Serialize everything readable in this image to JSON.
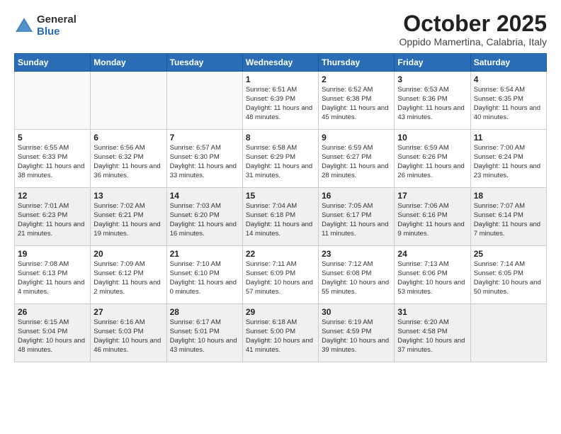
{
  "logo": {
    "general": "General",
    "blue": "Blue"
  },
  "title": "October 2025",
  "subtitle": "Oppido Mamertina, Calabria, Italy",
  "days_header": [
    "Sunday",
    "Monday",
    "Tuesday",
    "Wednesday",
    "Thursday",
    "Friday",
    "Saturday"
  ],
  "weeks": [
    [
      {
        "day": "",
        "info": "",
        "empty": true
      },
      {
        "day": "",
        "info": "",
        "empty": true
      },
      {
        "day": "",
        "info": "",
        "empty": true
      },
      {
        "day": "1",
        "info": "Sunrise: 6:51 AM\nSunset: 6:39 PM\nDaylight: 11 hours\nand 48 minutes."
      },
      {
        "day": "2",
        "info": "Sunrise: 6:52 AM\nSunset: 6:38 PM\nDaylight: 11 hours\nand 45 minutes."
      },
      {
        "day": "3",
        "info": "Sunrise: 6:53 AM\nSunset: 6:36 PM\nDaylight: 11 hours\nand 43 minutes."
      },
      {
        "day": "4",
        "info": "Sunrise: 6:54 AM\nSunset: 6:35 PM\nDaylight: 11 hours\nand 40 minutes."
      }
    ],
    [
      {
        "day": "5",
        "info": "Sunrise: 6:55 AM\nSunset: 6:33 PM\nDaylight: 11 hours\nand 38 minutes."
      },
      {
        "day": "6",
        "info": "Sunrise: 6:56 AM\nSunset: 6:32 PM\nDaylight: 11 hours\nand 36 minutes."
      },
      {
        "day": "7",
        "info": "Sunrise: 6:57 AM\nSunset: 6:30 PM\nDaylight: 11 hours\nand 33 minutes."
      },
      {
        "day": "8",
        "info": "Sunrise: 6:58 AM\nSunset: 6:29 PM\nDaylight: 11 hours\nand 31 minutes."
      },
      {
        "day": "9",
        "info": "Sunrise: 6:59 AM\nSunset: 6:27 PM\nDaylight: 11 hours\nand 28 minutes."
      },
      {
        "day": "10",
        "info": "Sunrise: 6:59 AM\nSunset: 6:26 PM\nDaylight: 11 hours\nand 26 minutes."
      },
      {
        "day": "11",
        "info": "Sunrise: 7:00 AM\nSunset: 6:24 PM\nDaylight: 11 hours\nand 23 minutes."
      }
    ],
    [
      {
        "day": "12",
        "info": "Sunrise: 7:01 AM\nSunset: 6:23 PM\nDaylight: 11 hours\nand 21 minutes.",
        "shaded": true
      },
      {
        "day": "13",
        "info": "Sunrise: 7:02 AM\nSunset: 6:21 PM\nDaylight: 11 hours\nand 19 minutes.",
        "shaded": true
      },
      {
        "day": "14",
        "info": "Sunrise: 7:03 AM\nSunset: 6:20 PM\nDaylight: 11 hours\nand 16 minutes.",
        "shaded": true
      },
      {
        "day": "15",
        "info": "Sunrise: 7:04 AM\nSunset: 6:18 PM\nDaylight: 11 hours\nand 14 minutes.",
        "shaded": true
      },
      {
        "day": "16",
        "info": "Sunrise: 7:05 AM\nSunset: 6:17 PM\nDaylight: 11 hours\nand 11 minutes.",
        "shaded": true
      },
      {
        "day": "17",
        "info": "Sunrise: 7:06 AM\nSunset: 6:16 PM\nDaylight: 11 hours\nand 9 minutes.",
        "shaded": true
      },
      {
        "day": "18",
        "info": "Sunrise: 7:07 AM\nSunset: 6:14 PM\nDaylight: 11 hours\nand 7 minutes.",
        "shaded": true
      }
    ],
    [
      {
        "day": "19",
        "info": "Sunrise: 7:08 AM\nSunset: 6:13 PM\nDaylight: 11 hours\nand 4 minutes."
      },
      {
        "day": "20",
        "info": "Sunrise: 7:09 AM\nSunset: 6:12 PM\nDaylight: 11 hours\nand 2 minutes."
      },
      {
        "day": "21",
        "info": "Sunrise: 7:10 AM\nSunset: 6:10 PM\nDaylight: 11 hours\nand 0 minutes."
      },
      {
        "day": "22",
        "info": "Sunrise: 7:11 AM\nSunset: 6:09 PM\nDaylight: 10 hours\nand 57 minutes."
      },
      {
        "day": "23",
        "info": "Sunrise: 7:12 AM\nSunset: 6:08 PM\nDaylight: 10 hours\nand 55 minutes."
      },
      {
        "day": "24",
        "info": "Sunrise: 7:13 AM\nSunset: 6:06 PM\nDaylight: 10 hours\nand 53 minutes."
      },
      {
        "day": "25",
        "info": "Sunrise: 7:14 AM\nSunset: 6:05 PM\nDaylight: 10 hours\nand 50 minutes."
      }
    ],
    [
      {
        "day": "26",
        "info": "Sunrise: 6:15 AM\nSunset: 5:04 PM\nDaylight: 10 hours\nand 48 minutes.",
        "shaded": true
      },
      {
        "day": "27",
        "info": "Sunrise: 6:16 AM\nSunset: 5:03 PM\nDaylight: 10 hours\nand 46 minutes.",
        "shaded": true
      },
      {
        "day": "28",
        "info": "Sunrise: 6:17 AM\nSunset: 5:01 PM\nDaylight: 10 hours\nand 43 minutes.",
        "shaded": true
      },
      {
        "day": "29",
        "info": "Sunrise: 6:18 AM\nSunset: 5:00 PM\nDaylight: 10 hours\nand 41 minutes.",
        "shaded": true
      },
      {
        "day": "30",
        "info": "Sunrise: 6:19 AM\nSunset: 4:59 PM\nDaylight: 10 hours\nand 39 minutes.",
        "shaded": true
      },
      {
        "day": "31",
        "info": "Sunrise: 6:20 AM\nSunset: 4:58 PM\nDaylight: 10 hours\nand 37 minutes.",
        "shaded": true
      },
      {
        "day": "",
        "info": "",
        "empty": true,
        "shaded": true
      }
    ]
  ]
}
